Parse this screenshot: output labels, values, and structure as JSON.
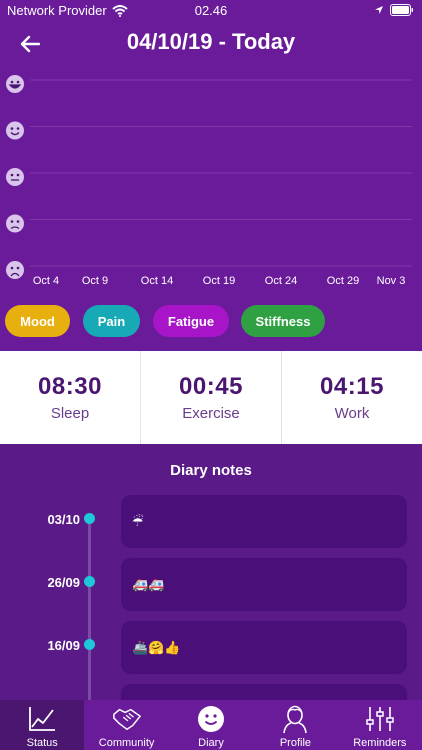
{
  "status_bar": {
    "carrier": "Network Provider",
    "time": "02.46"
  },
  "header": {
    "title": "04/10/19 - Today"
  },
  "chart_data": {
    "type": "line",
    "x": [
      "Oct 4",
      "Oct 9",
      "Oct 14",
      "Oct 19",
      "Oct 24",
      "Oct 29",
      "Nov 3"
    ],
    "y_levels": 5,
    "series": [],
    "grid": true
  },
  "filters": [
    {
      "label": "Mood",
      "color": "#e8b00f"
    },
    {
      "label": "Pain",
      "color": "#17a9b5"
    },
    {
      "label": "Fatigue",
      "color": "#a815c9"
    },
    {
      "label": "Stiffness",
      "color": "#2fa143"
    }
  ],
  "stats": [
    {
      "value": "08:30",
      "label": "Sleep"
    },
    {
      "value": "00:45",
      "label": "Exercise"
    },
    {
      "value": "04:15",
      "label": "Work"
    }
  ],
  "diary": {
    "title": "Diary notes",
    "entries": [
      {
        "date": "03/10",
        "note": "☔"
      },
      {
        "date": "26/09",
        "note": "🚑🚑"
      },
      {
        "date": "16/09",
        "note": "🚢🤗👍"
      },
      {
        "date": "",
        "note": ""
      }
    ]
  },
  "tabs": [
    {
      "label": "Status",
      "icon": "chart-icon",
      "active": true
    },
    {
      "label": "Community",
      "icon": "handshake-icon",
      "active": false
    },
    {
      "label": "Diary",
      "icon": "smiley-icon",
      "active": false
    },
    {
      "label": "Profile",
      "icon": "person-icon",
      "active": false
    },
    {
      "label": "Reminders",
      "icon": "sliders-icon",
      "active": false
    }
  ],
  "colors": {
    "primary": "#6a1b9a",
    "dark": "#4a1670",
    "diary_bg": "#5a1a87",
    "timeline_dot": "#1fc8d8"
  }
}
